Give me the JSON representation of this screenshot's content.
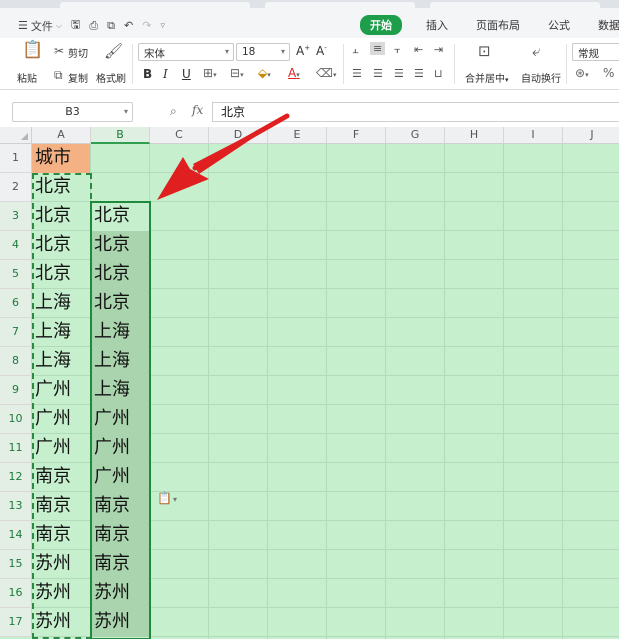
{
  "menu": {
    "file_label": "文件",
    "tabs": [
      {
        "label": "开始",
        "active": true
      },
      {
        "label": "插入",
        "active": false
      },
      {
        "label": "页面布局",
        "active": false
      },
      {
        "label": "公式",
        "active": false
      },
      {
        "label": "数据",
        "active": false
      }
    ]
  },
  "ribbon": {
    "paste_label": "粘贴",
    "cut_label": "剪切",
    "copy_label": "复制",
    "format_painter_label": "格式刷",
    "font_name": "宋体",
    "font_size": "18",
    "merge_label": "合并居中",
    "wrap_label": "自动换行",
    "number_format": "常规"
  },
  "formula_bar": {
    "name_box": "B3",
    "fx_label": "fx",
    "formula": "北京"
  },
  "sheet": {
    "columns": [
      "A",
      "B",
      "C",
      "D",
      "E",
      "F",
      "G",
      "H",
      "I",
      "J"
    ],
    "rows": [
      "1",
      "2",
      "3",
      "4",
      "5",
      "6",
      "7",
      "8",
      "9",
      "10",
      "11",
      "12",
      "13",
      "14",
      "15",
      "16",
      "17"
    ],
    "col_a": [
      "城市",
      "北京",
      "北京",
      "北京",
      "北京",
      "上海",
      "上海",
      "上海",
      "广州",
      "广州",
      "广州",
      "南京",
      "南京",
      "南京",
      "苏州",
      "苏州",
      "苏州"
    ],
    "col_b": [
      "",
      "",
      "北京",
      "北京",
      "北京",
      "北京",
      "上海",
      "上海",
      "上海",
      "广州",
      "广州",
      "广州",
      "南京",
      "南京",
      "南京",
      "苏州",
      "苏州"
    ],
    "active_cell": "B3"
  },
  "colors": {
    "accent": "#1e9e4a",
    "sheet_fill": "#c6efce",
    "header_fill": "#f4b183",
    "selection_fill": "#a9d4ae",
    "arrow": "#e02020"
  }
}
